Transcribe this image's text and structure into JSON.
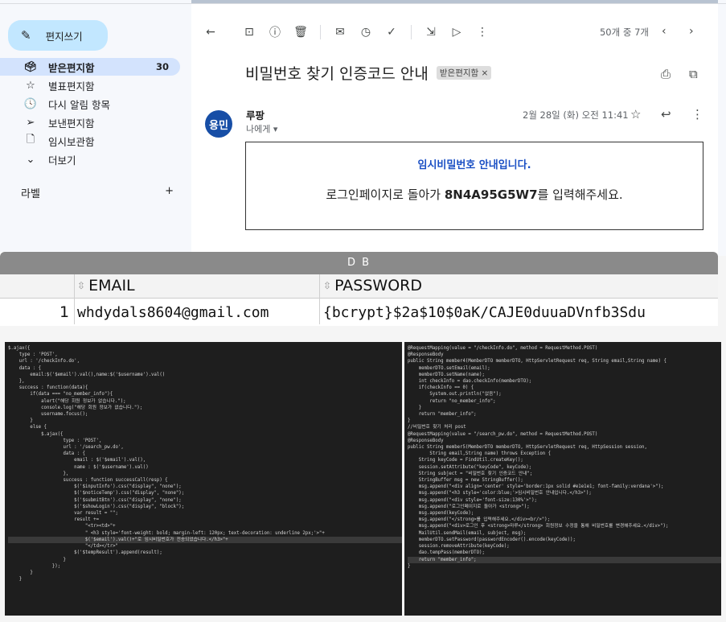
{
  "gmail": {
    "compose_label": "편지쓰기",
    "nav": [
      {
        "label": "받은편지함",
        "count": "30",
        "icon": "inbox-icon",
        "glyph": "🗳",
        "active": true
      },
      {
        "label": "별표편지함",
        "count": "",
        "icon": "star-icon",
        "glyph": "☆",
        "active": false
      },
      {
        "label": "다시 알림 항목",
        "count": "",
        "icon": "clock-icon",
        "glyph": "🕓",
        "active": false
      },
      {
        "label": "보낸편지함",
        "count": "",
        "icon": "send-icon",
        "glyph": "➢",
        "active": false
      },
      {
        "label": "임시보관함",
        "count": "",
        "icon": "draft-icon",
        "glyph": "🗋",
        "active": false
      },
      {
        "label": "더보기",
        "count": "",
        "icon": "chevron-down-icon",
        "glyph": "⌄",
        "active": false
      }
    ],
    "labels_heading": "라벨",
    "labels_add": "+",
    "pager": "50개 중 7개",
    "subject": "비밀번호 찾기 인증코드 안내",
    "tag": "받은편지함 ×",
    "avatar_text": "용민",
    "sender": "루팡",
    "to_me": "나에게 ▾",
    "date": "2월 28일 (화) 오전 11:41",
    "mail_heading": "임시비밀번호 안내입니다.",
    "mail_body_prefix": "로그인페이지로 돌아가 ",
    "mail_code": "8N4A95G5W7",
    "mail_body_suffix": "를 입력해주세요."
  },
  "db": {
    "title": "D B",
    "columns": [
      "EMAIL",
      "PASSWORD"
    ],
    "row_number": "1",
    "email": "whdydals8604@gmail.com",
    "password": "{bcrypt}$2a$10$0aK/CAJE0duuaDVnfb3Sdu"
  },
  "code_left": [
    "$.ajax({",
    "    type : 'POST',",
    "    url : '/checkInfo.do',",
    "    data : {",
    "        email:$('$email').val(),name:$('$username').val()",
    "    },",
    "    success : function(data){",
    "        if(data === \"no_member_info\"){",
    "            alert(\"해당 회원 정보가 없습니다.\");",
    "            console.log(\"해당 회원 정보가 없습니다.\");",
    "            username.focus();",
    "        }",
    "        else {",
    "            $.ajax({",
    "                    type : 'POST',",
    "                    url : '/search_pw.do',",
    "                    data : {",
    "                        email : $('$email').val(),",
    "                        name : $('$username').val()",
    "                    },",
    "                    success : function successCall(resp) {",
    "                        $('$inputInfo').css(\"display\", \"none\");",
    "                        $('$noticeTemp').css(\"display\", \"none\");",
    "                        $('$submitBtn').css(\"display\", \"none\");",
    "                        $('$showLogin').css(\"display\", \"block\");",
    "                        var result = \"\";",
    "                        result +=",
    "                            \"<tr><td>\"+",
    "                            \" <h3 style='font-weight: bold; margin-left: 120px; text-decoration: underline 2px;'>\"+",
    "                            $('$email').val()+\"로 임시비밀번호가 전송되었습니다.</h3>\"+",
    "                            \"</td></tr>\"",
    "",
    "                        $('$tempResult').append(result);",
    "                    }",
    "                });",
    "        }",
    "    }"
  ],
  "code_right": [
    "@RequestMapping(value = \"/checkInfo.do\", method = RequestMethod.POST)",
    "@ResponseBody",
    "public String member4(MemberDTO memberDTO, HttpServletRequest req, String email,String name) {",
    "",
    "    memberDTO.setEmail(email);",
    "    memberDTO.setName(name);",
    "    int checkInfo = dao.checkInfo(memberDTO);",
    "",
    "    if(checkInfo == 0) {",
    "        System.out.println(\"없음\");",
    "        return \"no_member_info\";",
    "    }",
    "    return \"member_info\";",
    "}",
    "//비밀번호 찾기 처리 post",
    "@RequestMapping(value = \"/search_pw.do\", method = RequestMethod.POST)",
    "@ResponseBody",
    "public String member5(MemberDTO memberDTO, HttpServletRequest req, HttpSession session,",
    "        String email,String name) throws Exception {",
    "    String keyCode = FindUtil.createKey();",
    "",
    "    session.setAttribute(\"keyCode\", keyCode);",
    "    String subject = \"비밀번호 찾기 인증코드 안내\";",
    "    StringBuffer msg = new StringBuffer();",
    "    msg.append(\"<div align='center' style='border:1px solid #e1e1e1; font-family:verdana'>\");",
    "    msg.append(\"<h3 style='color:blue;'>임시비밀번호 안내입니다.</h3>\");",
    "    msg.append(\"<div style='font-size:130%'>\");",
    "    msg.append(\"로그인페이지로 돌아가 <strong>\");",
    "    msg.append(keyCode);",
    "    msg.append(\"</strong>를 입력해주세요.</div><br/>\");",
    "    msg.append(\"<div>로그인 후 <strong>마루</strong> 회원정보 수정을 통해 비밀번호를 변경해주세요.</div>\");",
    "",
    "    MailUtil.sendMail(email, subject, msg);",
    "",
    "    memberDTO.setPassword(passwordEncoder().encode(keyCode));",
    "    session.removeAttribute(keyCode);",
    "",
    "    dao.tempPass(memberDTO);",
    "    return \"member_info\";",
    "}"
  ]
}
